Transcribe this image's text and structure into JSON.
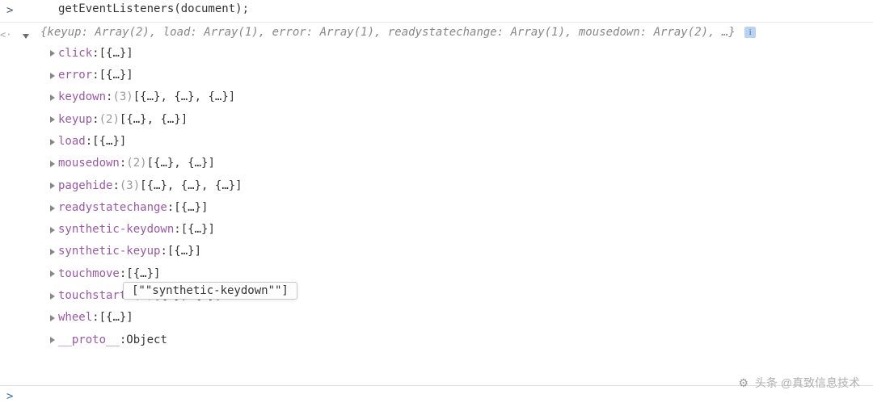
{
  "input_prompt": ">",
  "output_prompt": "<·",
  "command": "getEventListeners(document);",
  "summary": "{keyup: Array(2), load: Array(1), error: Array(1), readystatechange: Array(1), mousedown: Array(2), …}",
  "info_glyph": "i",
  "properties": [
    {
      "key": "click",
      "count": null,
      "values": "[{…}]"
    },
    {
      "key": "error",
      "count": null,
      "values": "[{…}]"
    },
    {
      "key": "keydown",
      "count": "(3)",
      "values": "[{…}, {…}, {…}]"
    },
    {
      "key": "keyup",
      "count": "(2)",
      "values": "[{…}, {…}]"
    },
    {
      "key": "load",
      "count": null,
      "values": "[{…}]"
    },
    {
      "key": "mousedown",
      "count": "(2)",
      "values": "[{…}, {…}]"
    },
    {
      "key": "pagehide",
      "count": "(3)",
      "values": "[{…}, {…}, {…}]"
    },
    {
      "key": "readystatechange",
      "count": null,
      "values": "[{…}]"
    },
    {
      "key": "synthetic-keydown",
      "count": null,
      "values": "[{…}]"
    },
    {
      "key": "synthetic-keyup",
      "count": null,
      "values": "[{…}]"
    },
    {
      "key": "touchmove",
      "count": null,
      "values": "[{…}]"
    },
    {
      "key": "touchstart",
      "count": "(2)",
      "values": "[{…}, {…}]"
    },
    {
      "key": "wheel",
      "count": null,
      "values": "[{…}]"
    }
  ],
  "proto": {
    "key": "__proto__",
    "value": "Object"
  },
  "tooltip": "[\"\"synthetic-keydown\"\"]",
  "watermark": "头条 @真致信息技术",
  "bottom_prompt": ">"
}
